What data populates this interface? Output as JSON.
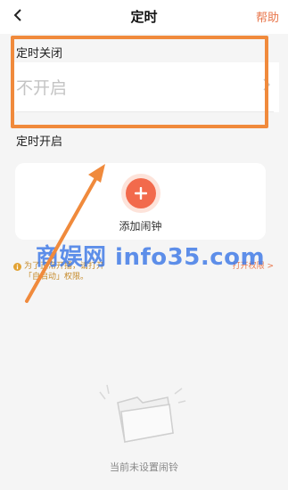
{
  "header": {
    "title": "定时",
    "help_label": "帮助"
  },
  "timer_off": {
    "label": "定时关闭",
    "value": "不开启"
  },
  "timer_on": {
    "label": "定时开启"
  },
  "add_alarm": {
    "label": "添加闹钟"
  },
  "notice": {
    "line1": "为了正常开播，请打开",
    "line2": "「自启动」权限。",
    "action": "打开权限 >"
  },
  "watermark": "商娱网 info35.com",
  "empty_state": {
    "text": "当前未设置闹铃"
  },
  "colors": {
    "accent": "#f26a4c",
    "highlight": "#f08a3c",
    "placeholder": "#c4c4c4"
  }
}
